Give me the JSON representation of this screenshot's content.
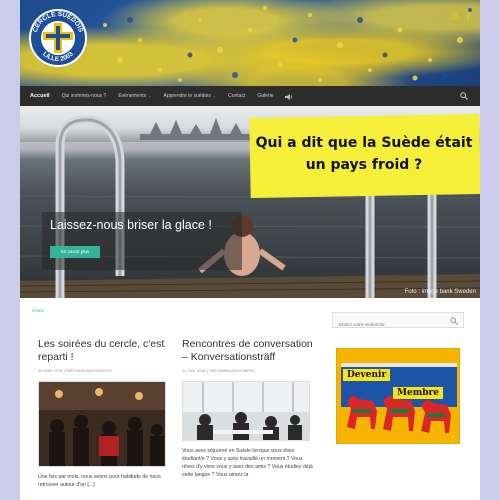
{
  "header": {
    "logo_text_top": "CERCLE SUÉDOIS",
    "logo_text_bottom": "LILLE 2003",
    "social_icons": [
      "rss-icon",
      "facebook-icon"
    ]
  },
  "nav": {
    "items": [
      "Accueil",
      "Qui sommes-nous ?",
      "Evénements",
      "Apprendre le suédois",
      "Contact",
      "Galerie"
    ],
    "active_index": 0
  },
  "hero": {
    "banner_line1": "Qui a dit que la Suède était",
    "banner_line2": "un pays froid ?",
    "caption": "Laissez-nous briser la glace !",
    "button": "En savoir plus",
    "credit": "Foto : image bank Sweden"
  },
  "breadcrumb": "Home",
  "posts": [
    {
      "title": "Les soirées du cercle, c'est reparti !",
      "meta": "26 MAR 2018  |  PAR HANNAMOSSBERG",
      "excerpt": "Une fois par mois, nous avons pour habitude de nous retrouver autour d'un [...]"
    },
    {
      "title": "Rencontres de conversation – Konversationsträff",
      "meta": "12 JUIL 2018  |  PAR HANNAMOSSBERG",
      "excerpt": "Vous avez séjourné en Suède lorsque vous étiez étudiant/e ? Vous y avez travaillé un moment ? Vous rêvez d'y vivre  vous y avez des amis ? Vous étudiez déjà cette langue ? Vous aimez la"
    }
  ],
  "sidebar": {
    "search_placeholder": "Entrez votre recherche",
    "ad_line1": "Devenir",
    "ad_line2": "Membre"
  },
  "colors": {
    "nav_bg": "#2d2d2d",
    "accent": "#35b39a",
    "banner": "#f6ef3a",
    "ad_bg": "#f4b400"
  }
}
